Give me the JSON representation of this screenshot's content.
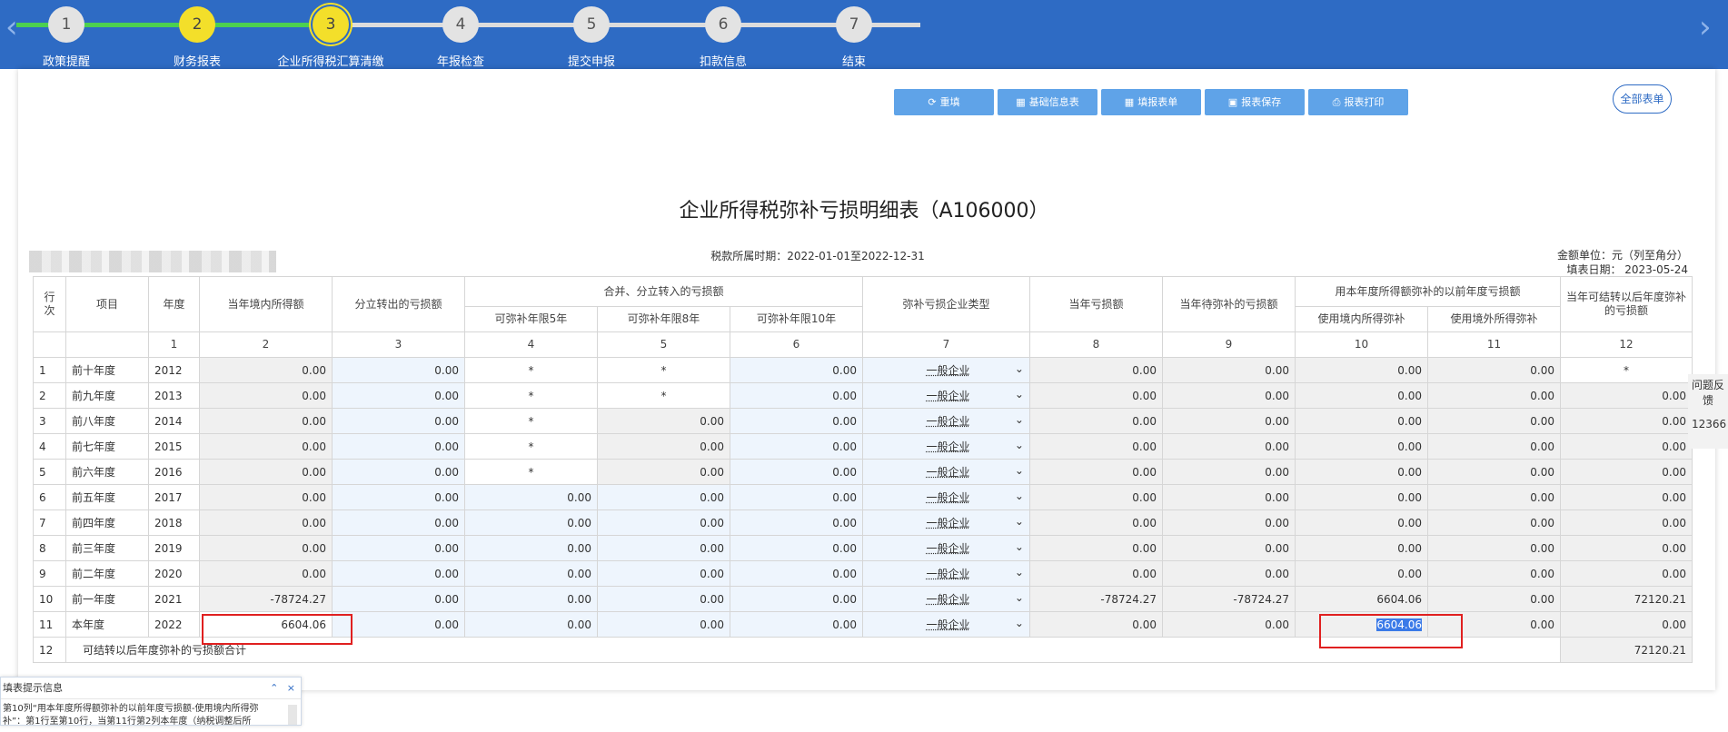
{
  "steps": [
    {
      "num": "1",
      "label": "政策提醒"
    },
    {
      "num": "2",
      "label": "财务报表"
    },
    {
      "num": "3",
      "label": "企业所得税汇算清缴"
    },
    {
      "num": "4",
      "label": "年报检查"
    },
    {
      "num": "5",
      "label": "提交申报"
    },
    {
      "num": "6",
      "label": "扣款信息"
    },
    {
      "num": "7",
      "label": "结束"
    }
  ],
  "nav": {
    "prev": "‹",
    "next": "›"
  },
  "toolbar": {
    "reset": "重填",
    "basic_info": "基础信息表",
    "fill_forms": "填报表单",
    "save": "报表保存",
    "print": "报表打印",
    "all_forms": "全部表单"
  },
  "report": {
    "title": "企业所得税弥补亏损明细表（A106000）",
    "period": "税款所属时期：2022-01-01至2022-12-31",
    "unit": "金额单位：元（列至角分）",
    "fill_date": "填表日期：   2023-05-24"
  },
  "headers": {
    "row_no": "行次",
    "item": "项目",
    "year": "年度",
    "domestic_income": "当年境内所得额",
    "split_out": "分立转出的亏损额",
    "merge_in": "合并、分立转入的亏损额",
    "merge_5": "可弥补年限5年",
    "merge_8": "可弥补年限8年",
    "merge_10": "可弥补年限10年",
    "company_type": "弥补亏损企业类型",
    "loss": "当年亏损额",
    "to_offset": "当年待弥补的亏损额",
    "used_group": "用本年度所得额弥补的以前年度亏损额",
    "used_domestic": "使用境内所得弥补",
    "used_foreign": "使用境外所得弥补",
    "carry_forward": "当年可结转以后年度弥补的亏损额",
    "col_nums": [
      "1",
      "2",
      "3",
      "4",
      "5",
      "6",
      "7",
      "8",
      "9",
      "10",
      "11",
      "12"
    ]
  },
  "rows": [
    {
      "no": "1",
      "item": "前十年度",
      "year": "2012",
      "c2": "0.00",
      "c3": "0.00",
      "c4": "*",
      "c5": "*",
      "c6": "0.00",
      "c7": "一般企业",
      "c8": "0.00",
      "c9": "0.00",
      "c10": "0.00",
      "c11": "0.00",
      "c12": "*"
    },
    {
      "no": "2",
      "item": "前九年度",
      "year": "2013",
      "c2": "0.00",
      "c3": "0.00",
      "c4": "*",
      "c5": "*",
      "c6": "0.00",
      "c7": "一般企业",
      "c8": "0.00",
      "c9": "0.00",
      "c10": "0.00",
      "c11": "0.00",
      "c12": "0.00"
    },
    {
      "no": "3",
      "item": "前八年度",
      "year": "2014",
      "c2": "0.00",
      "c3": "0.00",
      "c4": "*",
      "c5": "0.00",
      "c6": "0.00",
      "c7": "一般企业",
      "c8": "0.00",
      "c9": "0.00",
      "c10": "0.00",
      "c11": "0.00",
      "c12": "0.00"
    },
    {
      "no": "4",
      "item": "前七年度",
      "year": "2015",
      "c2": "0.00",
      "c3": "0.00",
      "c4": "*",
      "c5": "0.00",
      "c6": "0.00",
      "c7": "一般企业",
      "c8": "0.00",
      "c9": "0.00",
      "c10": "0.00",
      "c11": "0.00",
      "c12": "0.00"
    },
    {
      "no": "5",
      "item": "前六年度",
      "year": "2016",
      "c2": "0.00",
      "c3": "0.00",
      "c4": "*",
      "c5": "0.00",
      "c6": "0.00",
      "c7": "一般企业",
      "c8": "0.00",
      "c9": "0.00",
      "c10": "0.00",
      "c11": "0.00",
      "c12": "0.00"
    },
    {
      "no": "6",
      "item": "前五年度",
      "year": "2017",
      "c2": "0.00",
      "c3": "0.00",
      "c4": "0.00",
      "c5": "0.00",
      "c6": "0.00",
      "c7": "一般企业",
      "c8": "0.00",
      "c9": "0.00",
      "c10": "0.00",
      "c11": "0.00",
      "c12": "0.00"
    },
    {
      "no": "7",
      "item": "前四年度",
      "year": "2018",
      "c2": "0.00",
      "c3": "0.00",
      "c4": "0.00",
      "c5": "0.00",
      "c6": "0.00",
      "c7": "一般企业",
      "c8": "0.00",
      "c9": "0.00",
      "c10": "0.00",
      "c11": "0.00",
      "c12": "0.00"
    },
    {
      "no": "8",
      "item": "前三年度",
      "year": "2019",
      "c2": "0.00",
      "c3": "0.00",
      "c4": "0.00",
      "c5": "0.00",
      "c6": "0.00",
      "c7": "一般企业",
      "c8": "0.00",
      "c9": "0.00",
      "c10": "0.00",
      "c11": "0.00",
      "c12": "0.00"
    },
    {
      "no": "9",
      "item": "前二年度",
      "year": "2020",
      "c2": "0.00",
      "c3": "0.00",
      "c4": "0.00",
      "c5": "0.00",
      "c6": "0.00",
      "c7": "一般企业",
      "c8": "0.00",
      "c9": "0.00",
      "c10": "0.00",
      "c11": "0.00",
      "c12": "0.00"
    },
    {
      "no": "10",
      "item": "前一年度",
      "year": "2021",
      "c2": "-78724.27",
      "c3": "0.00",
      "c4": "0.00",
      "c5": "0.00",
      "c6": "0.00",
      "c7": "一般企业",
      "c8": "-78724.27",
      "c9": "-78724.27",
      "c10": "6604.06",
      "c11": "0.00",
      "c12": "72120.21"
    },
    {
      "no": "11",
      "item": "本年度",
      "year": "2022",
      "c2": "6604.06",
      "c3": "0.00",
      "c4": "0.00",
      "c5": "0.00",
      "c6": "0.00",
      "c7": "一般企业",
      "c8": "0.00",
      "c9": "0.00",
      "c10": "6604.06",
      "c11": "0.00",
      "c12": "0.00"
    }
  ],
  "total": {
    "no": "12",
    "label": "可结转以后年度弥补的亏损额合计",
    "value": "72120.21"
  },
  "feedback": {
    "label": "问题反馈",
    "tail": "12366"
  },
  "tip_panel": {
    "title": "填表提示信息",
    "collapse": "⌃",
    "close": "×",
    "body1": "第10列“用本年度所得额弥补的以前年度亏损额-使用境内所得弥",
    "body2": "补”：第1行至第10行，当第11行第2列本年度（纳税调整后所"
  },
  "colors": {
    "topbar": "#2e6bc4",
    "button": "#5fa3e8",
    "highlight": "#e02020"
  }
}
